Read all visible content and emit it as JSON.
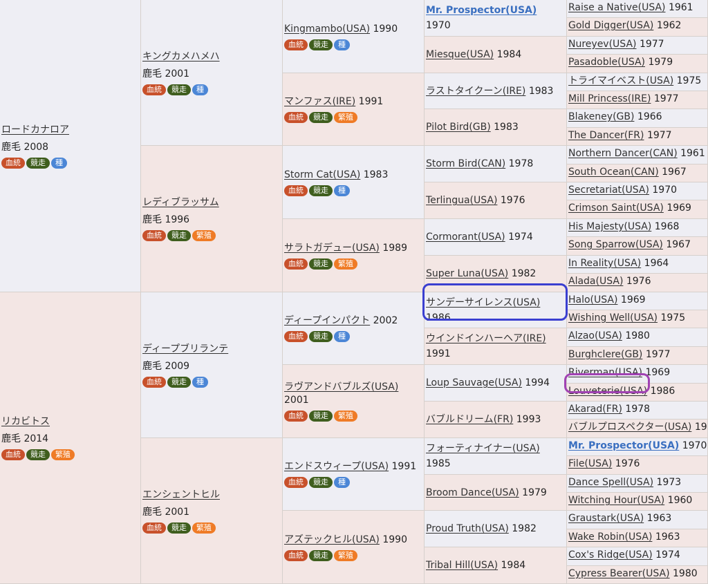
{
  "tags": {
    "blood": "血統",
    "race": "競走",
    "stud": "種",
    "breed": "繁殖"
  },
  "g1": [
    {
      "name": "ロードカナロア",
      "info": "鹿毛 2008",
      "tags": [
        "blood",
        "race",
        "stud"
      ]
    },
    {
      "name": "リカビトス",
      "info": "鹿毛 2014",
      "tags": [
        "blood",
        "race",
        "breed"
      ]
    }
  ],
  "g2": [
    {
      "name": "キングカメハメハ",
      "info": "鹿毛 2001",
      "tags": [
        "blood",
        "race",
        "stud"
      ]
    },
    {
      "name": "レディブラッサム",
      "info": "鹿毛 1996",
      "tags": [
        "blood",
        "race",
        "breed"
      ]
    },
    {
      "name": "ディープブリランテ",
      "info": "鹿毛 2009",
      "tags": [
        "blood",
        "race",
        "stud"
      ]
    },
    {
      "name": "エンシェントヒル",
      "info": "鹿毛 2001",
      "tags": [
        "blood",
        "race",
        "breed"
      ]
    }
  ],
  "g3": [
    {
      "name": "Kingmambo(USA)",
      "year": "1990",
      "tags": [
        "blood",
        "race",
        "stud"
      ]
    },
    {
      "name": "マンファス(IRE)",
      "year": "1991",
      "tags": [
        "blood",
        "race",
        "breed"
      ]
    },
    {
      "name": "Storm Cat(USA)",
      "year": "1983",
      "tags": [
        "blood",
        "race",
        "stud"
      ]
    },
    {
      "name": "サラトガデュー(USA)",
      "year": "1989",
      "tags": [
        "blood",
        "race",
        "breed"
      ]
    },
    {
      "name": "ディープインパクト",
      "year": "2002",
      "tags": [
        "blood",
        "race",
        "stud"
      ]
    },
    {
      "name": "ラヴアンドバブルズ(USA)",
      "year": "2001",
      "tags": [
        "blood",
        "race",
        "breed"
      ]
    },
    {
      "name": "エンドスウィープ(USA)",
      "year": "1991",
      "tags": [
        "blood",
        "race",
        "stud"
      ]
    },
    {
      "name": "アズテックヒル(USA)",
      "year": "1990",
      "tags": [
        "blood",
        "race",
        "breed"
      ]
    }
  ],
  "g4": [
    {
      "name": "Mr. Prospector(USA)",
      "year": "1970",
      "bold": true
    },
    {
      "name": "Miesque(USA)",
      "year": "1984"
    },
    {
      "name": "ラストタイクーン(IRE)",
      "year": "1983"
    },
    {
      "name": "Pilot Bird(GB)",
      "year": "1983"
    },
    {
      "name": "Storm Bird(CAN)",
      "year": "1978"
    },
    {
      "name": "Terlingua(USA)",
      "year": "1976"
    },
    {
      "name": "Cormorant(USA)",
      "year": "1974"
    },
    {
      "name": "Super Luna(USA)",
      "year": "1982"
    },
    {
      "name": "サンデーサイレンス(USA)",
      "year": "1986"
    },
    {
      "name": "ウインドインハーヘア(IRE)",
      "year": "1991"
    },
    {
      "name": "Loup Sauvage(USA)",
      "year": "1994"
    },
    {
      "name": "バブルドリーム(FR)",
      "year": "1993"
    },
    {
      "name": "フォーティナイナー(USA)",
      "year": "1985"
    },
    {
      "name": "Broom Dance(USA)",
      "year": "1979"
    },
    {
      "name": "Proud Truth(USA)",
      "year": "1982"
    },
    {
      "name": "Tribal Hill(USA)",
      "year": "1984"
    }
  ],
  "g5": [
    {
      "name": "Raise a Native(USA)",
      "year": "1961"
    },
    {
      "name": "Gold Digger(USA)",
      "year": "1962"
    },
    {
      "name": "Nureyev(USA)",
      "year": "1977"
    },
    {
      "name": "Pasadoble(USA)",
      "year": "1979"
    },
    {
      "name": "トライマイベスト(USA)",
      "year": "1975"
    },
    {
      "name": "Mill Princess(IRE)",
      "year": "1977"
    },
    {
      "name": "Blakeney(GB)",
      "year": "1966"
    },
    {
      "name": "The Dancer(FR)",
      "year": "1977"
    },
    {
      "name": "Northern Dancer(CAN)",
      "year": "1961"
    },
    {
      "name": "South Ocean(CAN)",
      "year": "1967"
    },
    {
      "name": "Secretariat(USA)",
      "year": "1970"
    },
    {
      "name": "Crimson Saint(USA)",
      "year": "1969"
    },
    {
      "name": "His Majesty(USA)",
      "year": "1968"
    },
    {
      "name": "Song Sparrow(USA)",
      "year": "1967"
    },
    {
      "name": "In Reality(USA)",
      "year": "1964"
    },
    {
      "name": "Alada(USA)",
      "year": "1976"
    },
    {
      "name": "Halo(USA)",
      "year": "1969"
    },
    {
      "name": "Wishing Well(USA)",
      "year": "1975"
    },
    {
      "name": "Alzao(USA)",
      "year": "1980"
    },
    {
      "name": "Burghclere(GB)",
      "year": "1977"
    },
    {
      "name": "Riverman(USA)",
      "year": "1969"
    },
    {
      "name": "Louveterie(USA)",
      "year": "1986"
    },
    {
      "name": "Akarad(FR)",
      "year": "1978"
    },
    {
      "name": "バブルプロスペクター(USA)",
      "year": "1984"
    },
    {
      "name": "Mr. Prospector(USA)",
      "year": "1970",
      "bold": true
    },
    {
      "name": "File(USA)",
      "year": "1976"
    },
    {
      "name": "Dance Spell(USA)",
      "year": "1973"
    },
    {
      "name": "Witching Hour(USA)",
      "year": "1960"
    },
    {
      "name": "Graustark(USA)",
      "year": "1963"
    },
    {
      "name": "Wake Robin(USA)",
      "year": "1963"
    },
    {
      "name": "Cox's Ridge(USA)",
      "year": "1974"
    },
    {
      "name": "Cypress Bearer(USA)",
      "year": "1980"
    }
  ],
  "highlight_colors": {
    "blue": "#3a3fd0",
    "purple": "#a142b3"
  }
}
